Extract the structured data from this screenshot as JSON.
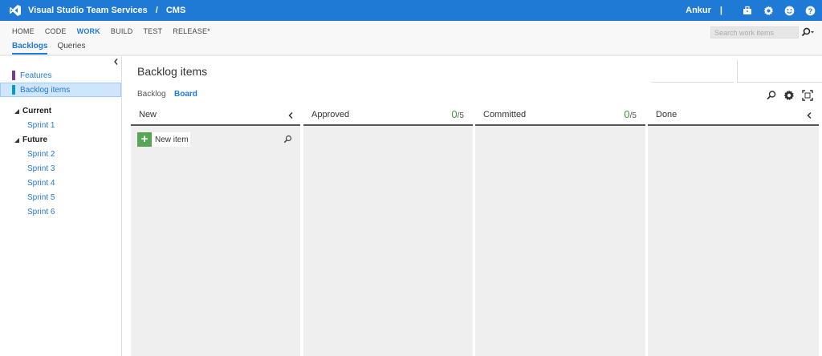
{
  "topbar": {
    "brand": "Visual Studio Team Services",
    "separator": "/",
    "project": "CMS",
    "user": "Ankur",
    "pipe": "|",
    "icons": [
      "briefcase-icon",
      "gear-icon",
      "smiley-icon",
      "help-icon"
    ],
    "color": "#1f7ad6"
  },
  "nav": {
    "items": [
      "HOME",
      "CODE",
      "WORK",
      "BUILD",
      "TEST",
      "RELEASE*"
    ],
    "active": "WORK"
  },
  "search": {
    "placeholder": "Search work items"
  },
  "subnav": {
    "tabs": [
      "Backlogs",
      "Queries"
    ],
    "active": "Backlogs"
  },
  "sidebar": {
    "backlogs": [
      {
        "label": "Features",
        "color": "#773b93"
      },
      {
        "label": "Backlog items",
        "color": "#009ccc"
      }
    ],
    "current_label": "Current",
    "current_sprints": [
      "Sprint 1"
    ],
    "future_label": "Future",
    "future_sprints": [
      "Sprint 2",
      "Sprint 3",
      "Sprint 4",
      "Sprint 5",
      "Sprint 6"
    ]
  },
  "main": {
    "title": "Backlog items",
    "view_tabs": [
      "Backlog",
      "Board"
    ],
    "active_view": "Board"
  },
  "board": {
    "columns": [
      {
        "name": "New"
      },
      {
        "name": "Approved",
        "count": "0",
        "limit": "/5"
      },
      {
        "name": "Committed",
        "count": "0",
        "limit": "/5"
      },
      {
        "name": "Done"
      }
    ],
    "new_item_label": "New item"
  }
}
